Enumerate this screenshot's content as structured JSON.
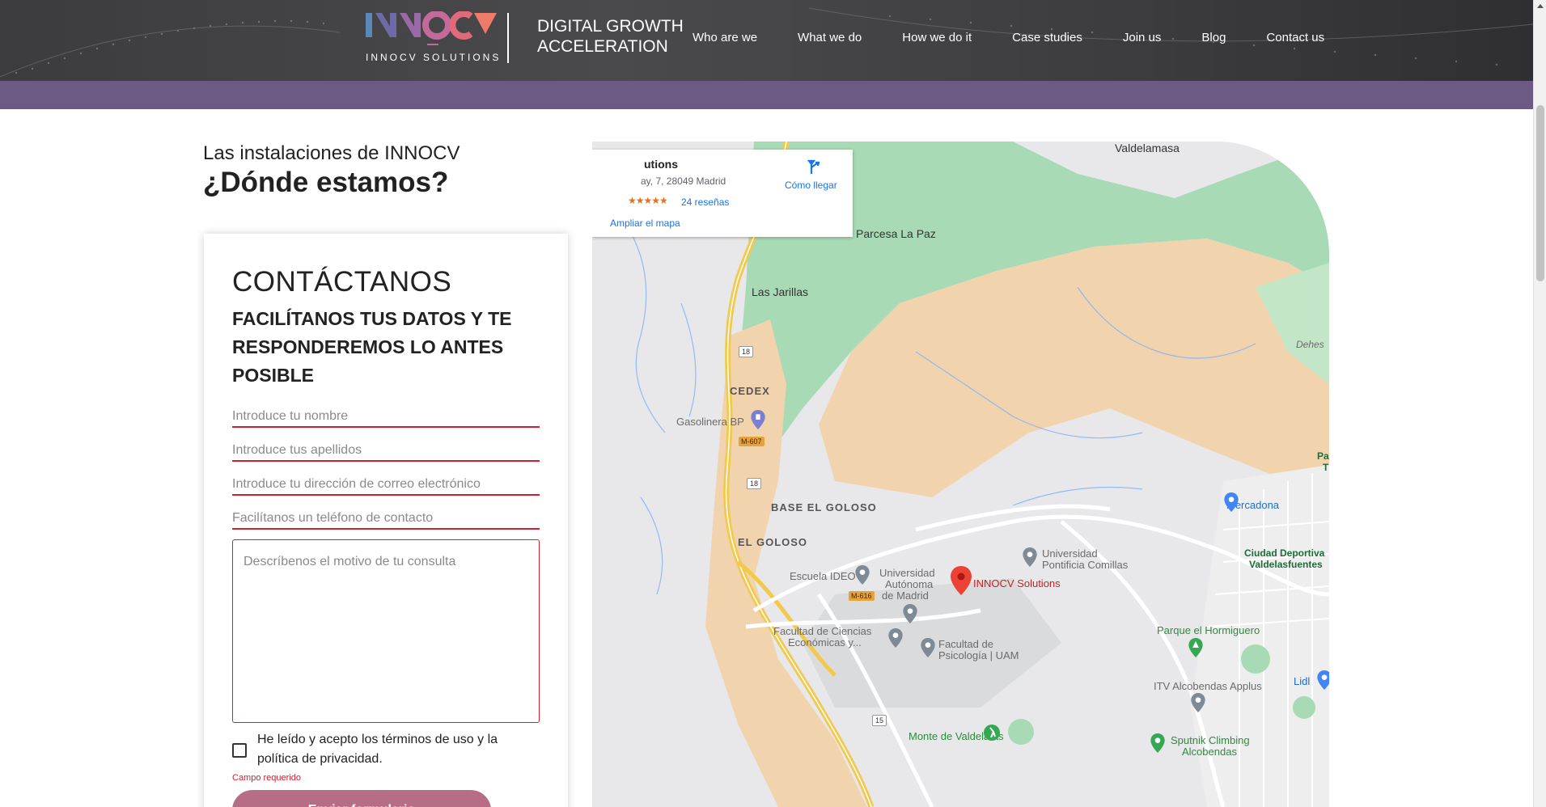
{
  "header": {
    "logo_text": "INNOCV SOLUTIONS",
    "tagline": "DIGITAL GROWTH ACCELERATION",
    "nav": [
      "Who are we",
      "What we do",
      "How we do it",
      "Case studies",
      "Join us",
      "Blog",
      "Contact us"
    ]
  },
  "location": {
    "subtitle": "Las instalaciones de INNOCV",
    "title": "¿Dónde estamos?"
  },
  "form": {
    "heading": "CONTÁCTANOS",
    "subheading": "FACILÍTANOS TUS DATOS Y TE RESPONDEREMOS LO ANTES POSIBLE",
    "name_placeholder": "Introduce tu nombre",
    "surname_placeholder": "Introduce tus apellidos",
    "email_placeholder": "Introduce tu dirección de correo electrónico",
    "phone_placeholder": "Facilítanos un teléfono de contacto",
    "message_placeholder": "Descríbenos el motivo de tu consulta",
    "terms_label": "He leído y acepto los términos de uso y la política de privacidad.",
    "required_label": "Campo requerido",
    "submit_label": "Enviar formulario"
  },
  "map": {
    "info": {
      "name": "utions",
      "address": "ay, 7, 28049 Madrid",
      "stars": "★★★★★",
      "reviews": "24 reseñas",
      "enlarge": "Ampliar el mapa",
      "directions": "Cómo llegar"
    },
    "labels": {
      "valdelamasa": "Valdelamasa",
      "parcesa": "Parcesa La Paz",
      "jarillas": "Las Jarillas",
      "dehes": "Dehes",
      "cedex": "CEDEX",
      "gasolinera": "Gasolinera BP",
      "base": "BASE EL GOLOSO",
      "goloso": "EL GOLOSO",
      "mercadona": "Mercadona",
      "pa": "Pa",
      "t": "T",
      "ciudad_deportiva_1": "Ciudad Deportiva",
      "ciudad_deportiva_2": "Valdelasfuentes",
      "comillas_1": "Universidad",
      "comillas_2": "Pontificia Comillas",
      "ideo": "Escuela IDEO",
      "uam_1": "Universidad",
      "uam_2": "Autónoma",
      "uam_3": "de Madrid",
      "innocv": "INNOCV Solutions",
      "economicas_1": "Facultad de Ciencias",
      "economicas_2": "Económicas y...",
      "psicologia_1": "Facultad de",
      "psicologia_2": "Psicología | UAM",
      "hormiguero": "Parque el Hormiguero",
      "itv": "ITV Alcobendas Applus",
      "lidl": "Lidl",
      "valdeletas": "Monte de Valdelatas",
      "sputnik_1": "Sputnik Climbing",
      "sputnik_2": "Alcobendas",
      "road_18a": "18",
      "road_m607": "M-607",
      "road_18b": "18",
      "road_m616": "M-616",
      "road_15": "15"
    }
  }
}
